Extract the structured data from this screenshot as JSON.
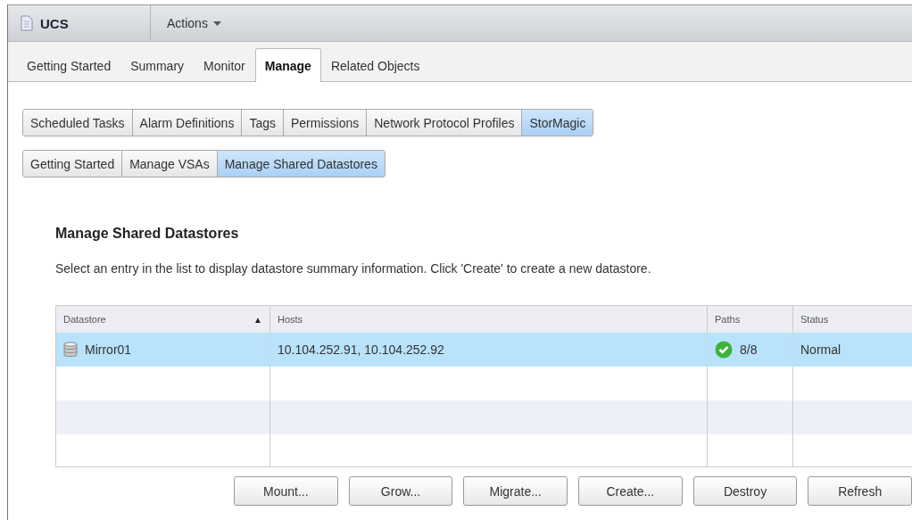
{
  "header": {
    "title": "UCS",
    "actions": "Actions"
  },
  "tabs": [
    {
      "label": "Getting Started",
      "selected": false
    },
    {
      "label": "Summary",
      "selected": false
    },
    {
      "label": "Monitor",
      "selected": false
    },
    {
      "label": "Manage",
      "selected": true
    },
    {
      "label": "Related Objects",
      "selected": false
    }
  ],
  "subtabs": [
    {
      "label": "Scheduled Tasks",
      "selected": false
    },
    {
      "label": "Alarm Definitions",
      "selected": false
    },
    {
      "label": "Tags",
      "selected": false
    },
    {
      "label": "Permissions",
      "selected": false
    },
    {
      "label": "Network Protocol Profiles",
      "selected": false
    },
    {
      "label": "StorMagic",
      "selected": true
    }
  ],
  "plugin_tabs": [
    {
      "label": "Getting Started",
      "selected": false
    },
    {
      "label": "Manage VSAs",
      "selected": false
    },
    {
      "label": "Manage Shared Datastores",
      "selected": true
    }
  ],
  "heading": "Manage Shared Datastores",
  "description": "Select an entry in the list to display datastore summary information. Click 'Create' to create a new datastore.",
  "table": {
    "columns": [
      {
        "label": "Datastore",
        "sort": "▲"
      },
      {
        "label": "Hosts"
      },
      {
        "label": "Paths"
      },
      {
        "label": "Status"
      }
    ],
    "rows": [
      {
        "datastore": "Mirror01",
        "hosts": "10.104.252.91, 10.104.252.92",
        "paths": "8/8",
        "paths_ok": true,
        "status": "Normal",
        "selected": true
      }
    ]
  },
  "buttons": [
    "Mount...",
    "Grow...",
    "Migrate...",
    "Create...",
    "Destroy",
    "Refresh"
  ]
}
